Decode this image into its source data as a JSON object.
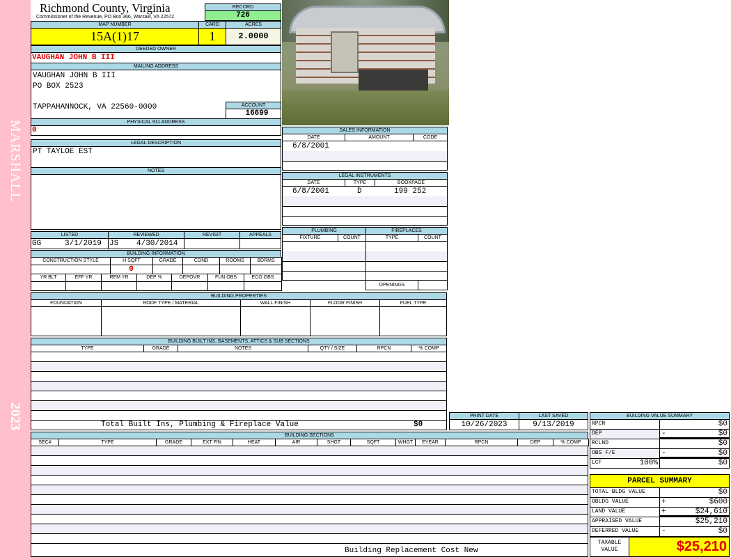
{
  "sidebar": {
    "district": "MARSHALL",
    "year": "2023"
  },
  "header": {
    "title": "Richmond County, Virginia",
    "subtitle": "Commissioner of the Revenue, PO Box 366, Warsaw, VA 22572"
  },
  "record": {
    "label": "RECORD",
    "value": "726"
  },
  "map": {
    "map_label": "MAP NUMBER",
    "map_value": "15A(1)17",
    "card_label": "CARD",
    "card_value": "1",
    "acres_label": "ACRES",
    "acres_value": "2.0000"
  },
  "owner": {
    "label": "DEEDED OWNER",
    "value": "VAUGHAN JOHN B III"
  },
  "mailing": {
    "label": "MAILING ADDRESS",
    "lines": [
      "VAUGHAN JOHN B III",
      "PO BOX 2523",
      "TAPPAHANNOCK, VA 22560-0000"
    ]
  },
  "account": {
    "label": "ACCOUNT",
    "value": "16699"
  },
  "physical": {
    "label": "PHYSICAL 911 ADDRESS",
    "value": "0"
  },
  "legal_description": {
    "label": "LEGAL DESCRIPTION",
    "value": "PT TAYLOE EST"
  },
  "notes": {
    "label": "NOTES"
  },
  "sales": {
    "label": "SALES INFORMATION",
    "columns": [
      "DATE",
      "AMOUNT",
      "CODE"
    ],
    "rows": [
      {
        "date": "6/8/2001",
        "amount": "",
        "code": ""
      }
    ]
  },
  "legal_instruments": {
    "label": "LEGAL INSTRUMENTS",
    "columns": [
      "DATE",
      "TYPE",
      "BOOKPAGE"
    ],
    "rows": [
      {
        "date": "6/8/2001",
        "type": "D",
        "bookpage": "199 252"
      }
    ]
  },
  "listing": {
    "columns": [
      "LISTED",
      "REVIEWED",
      "REVISIT",
      "APPEALS"
    ],
    "listed_by": "GG",
    "listed_date": "3/1/2019",
    "reviewed_by": "JS",
    "reviewed_date": "4/30/2014"
  },
  "building_info": {
    "label": "BUILDING INFORMATION",
    "columns1": [
      "CONSTRUCTION STYLE",
      "H SQFT",
      "GRADE",
      "COND",
      "ROOMS",
      "BDRMS"
    ],
    "hsqft": "0",
    "columns2": [
      "YR BLT",
      "EFF YR",
      "REM YR",
      "DEP %",
      "DEPOVR",
      "FUN OBS",
      "ECO OBS"
    ]
  },
  "plumbing": {
    "label": "PLUMBING",
    "columns": [
      "FIXTURE",
      "COUNT"
    ]
  },
  "fireplaces": {
    "label": "FIREPLACES",
    "columns": [
      "TYPE",
      "COUNT"
    ],
    "openings_label": "OPENINGS"
  },
  "building_properties": {
    "label": "BUILDING PROPERTIES",
    "columns": [
      "FOUNDATION",
      "ROOF TYPE / MATERIAL",
      "WALL FINISH",
      "FLOOR FINISH",
      "FUEL TYPE"
    ]
  },
  "built_ins": {
    "label": "BUILDING BUILT INS, BASEMENTS, ATTICS & SUB SECTIONS",
    "columns": [
      "TYPE",
      "GRADE",
      "NOTES",
      "QTY / SIZE",
      "RPCN",
      "% COMP"
    ],
    "total_label": "Total Built Ins, Plumbing & Fireplace Value",
    "total_value": "$0"
  },
  "dates": {
    "print_label": "PRINT DATE",
    "print_value": "10/26/2023",
    "saved_label": "LAST SAVED",
    "saved_value": "9/13/2019"
  },
  "building_sections": {
    "label": "BUILDING SECTIONS",
    "columns": [
      "SEC#",
      "TYPE",
      "GRADE",
      "EXT FIN",
      "HEAT",
      "AIR",
      "SHGT",
      "SQFT",
      "WHGT",
      "EYEAR",
      "RPCN",
      "DEP",
      "% COMP"
    ],
    "footer": "Building Replacement Cost New"
  },
  "value_summary": {
    "label": "BUILDING VALUE SUMMARY",
    "rows": [
      {
        "label": "RPCN",
        "extra": "",
        "sign": "",
        "value": "$0"
      },
      {
        "label": "DEP",
        "extra": "",
        "sign": "-",
        "value": "$0"
      },
      {
        "label": "RCLND",
        "extra": "",
        "sign": "",
        "value": "$0"
      },
      {
        "label": "OBS F/E",
        "extra": "",
        "sign": "-",
        "value": "$0"
      },
      {
        "label": "LCF",
        "extra": "100%",
        "sign": "",
        "value": "$0"
      }
    ]
  },
  "parcel_summary": {
    "label": "PARCEL SUMMARY",
    "rows": [
      {
        "label": "TOTAL BLDG VALUE",
        "sign": "",
        "value": "$0"
      },
      {
        "label": "OBLDG VALUE",
        "sign": "+",
        "value": "$600"
      },
      {
        "label": "LAND VALUE",
        "sign": "+",
        "value": "$24,610"
      },
      {
        "label": "APPRAISED VALUE",
        "sign": "",
        "value": "$25,210"
      },
      {
        "label": "DEFERRED VALUE",
        "sign": "-",
        "value": "$0"
      }
    ],
    "taxable_label": "TAXABLE VALUE",
    "taxable_value": "$25,210"
  },
  "colors": {
    "header_blue": "#add8e6",
    "record_green": "#90ee90",
    "highlight_yellow": "#ffff00",
    "owner_red": "#e00000",
    "sidebar_pink": "#ffc0cb"
  }
}
